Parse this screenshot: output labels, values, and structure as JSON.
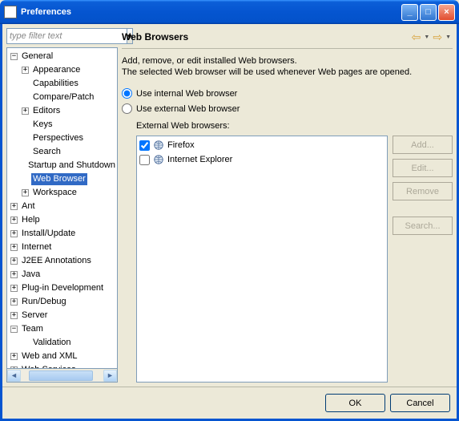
{
  "title": "Preferences",
  "filter_placeholder": "type filter text",
  "tree": {
    "general": "General",
    "appearance": "Appearance",
    "capabilities": "Capabilities",
    "compare": "Compare/Patch",
    "editors": "Editors",
    "keys": "Keys",
    "perspectives": "Perspectives",
    "search": "Search",
    "startup": "Startup and Shutdown",
    "web_browser": "Web Browser",
    "workspace": "Workspace",
    "ant": "Ant",
    "help": "Help",
    "install": "Install/Update",
    "internet": "Internet",
    "j2ee": "J2EE Annotations",
    "java": "Java",
    "plugin": "Plug-in Development",
    "rundebug": "Run/Debug",
    "server": "Server",
    "team": "Team",
    "validation": "Validation",
    "webxml": "Web and XML",
    "webservices": "Web Services"
  },
  "page": {
    "heading": "Web Browsers",
    "desc1": "Add, remove, or edit installed Web browsers.",
    "desc2": "The selected Web browser will be used whenever Web pages are opened.",
    "radio_internal": "Use internal Web browser",
    "radio_external": "Use external Web browser",
    "external_label": "External Web browsers:",
    "browsers": {
      "firefox": "Firefox",
      "ie": "Internet Explorer"
    },
    "buttons": {
      "add": "Add...",
      "edit": "Edit...",
      "remove": "Remove",
      "search": "Search..."
    }
  },
  "footer": {
    "ok": "OK",
    "cancel": "Cancel"
  }
}
